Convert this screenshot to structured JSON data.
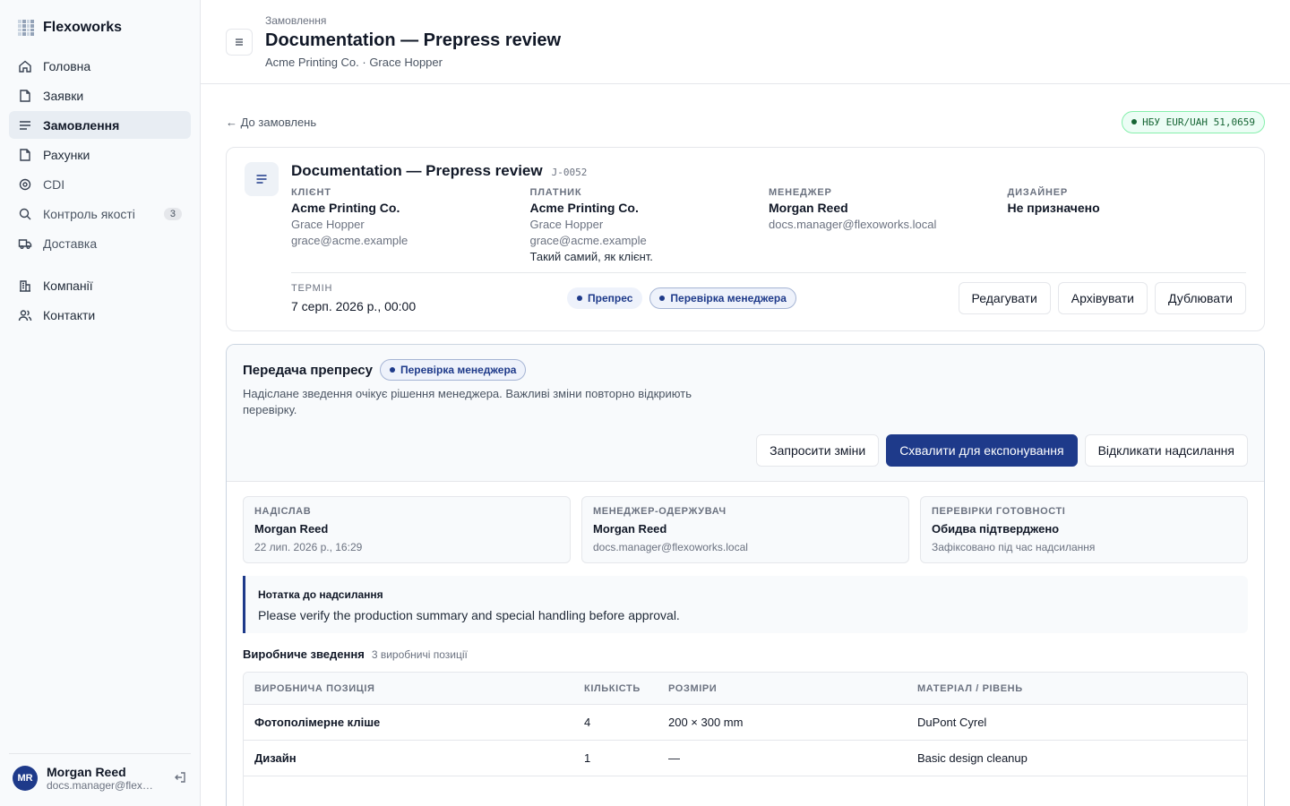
{
  "brand": {
    "name": "Flexoworks"
  },
  "sidebar": {
    "items": [
      {
        "label": "Головна",
        "icon": "home-icon"
      },
      {
        "label": "Заявки",
        "icon": "file-icon"
      },
      {
        "label": "Замовлення",
        "icon": "list-icon",
        "active": true
      },
      {
        "label": "Рахунки",
        "icon": "file-icon"
      },
      {
        "label": "CDI",
        "icon": "target-icon"
      },
      {
        "label": "Контроль якості",
        "icon": "search-icon",
        "count": "3"
      },
      {
        "label": "Доставка",
        "icon": "truck-icon"
      }
    ],
    "secondary": [
      {
        "label": "Компанії",
        "icon": "building-icon"
      },
      {
        "label": "Контакти",
        "icon": "users-icon"
      }
    ],
    "user": {
      "initials": "MR",
      "name": "Morgan Reed",
      "email": "docs.manager@flexoworks.local"
    }
  },
  "header": {
    "breadcrumb": "Замовлення",
    "title": "Documentation — Prepress review",
    "subtitle": "Acme Printing Co. · Grace Hopper"
  },
  "back_link": "← До замовлень",
  "rate": "НБУ EUR/UAH 51,0659",
  "order": {
    "title": "Documentation — Prepress review",
    "id": "J-0052",
    "client": {
      "label": "КЛІЄНТ",
      "name": "Acme Printing Co.",
      "contact": "Grace Hopper",
      "email": "grace@acme.example"
    },
    "payer": {
      "label": "ПЛАТНИК",
      "name": "Acme Printing Co.",
      "contact": "Grace Hopper",
      "email": "grace@acme.example",
      "note": "Такий самий, як клієнт."
    },
    "manager": {
      "label": "МЕНЕДЖЕР",
      "name": "Morgan Reed",
      "email": "docs.manager@flexoworks.local"
    },
    "designer": {
      "label": "ДИЗАЙНЕР",
      "name": "Не призначено"
    },
    "term": {
      "label": "ТЕРМІН",
      "value": "7 серп. 2026 р., 00:00"
    },
    "badges": [
      "Препрес",
      "Перевірка менеджера"
    ],
    "actions": {
      "edit": "Редагувати",
      "archive": "Архівувати",
      "duplicate": "Дублювати"
    }
  },
  "handoff": {
    "title": "Передача препресу",
    "badge": "Перевірка менеджера",
    "description": "Надіслане зведення очікує рішення менеджера. Важливі зміни повторно відкриють перевірку.",
    "actions": {
      "request": "Запросити зміни",
      "approve": "Схвалити для експонування",
      "recall": "Відкликати надсилання"
    },
    "sent_by": {
      "label": "НАДІСЛАВ",
      "value": "Morgan Reed",
      "sub": "22 лип. 2026 р., 16:29"
    },
    "recipient": {
      "label": "МЕНЕДЖЕР-ОДЕРЖУВАЧ",
      "value": "Morgan Reed",
      "sub": "docs.manager@flexoworks.local"
    },
    "readiness": {
      "label": "ПЕРЕВІРКИ ГОТОВНОСТІ",
      "value": "Обидва підтверджено",
      "sub": "Зафіксовано під час надсилання"
    },
    "note": {
      "title": "Нотатка до надсилання",
      "text": "Please verify the production summary and special handling before approval."
    },
    "summary": {
      "title": "Виробниче зведення",
      "count": "3 виробничі позиції",
      "headers": [
        "ВИРОБНИЧА ПОЗИЦІЯ",
        "КІЛЬКІСТЬ",
        "РОЗМІРИ",
        "МАТЕРІАЛ / РІВЕНЬ"
      ],
      "rows": [
        {
          "item": "Фотополімерне кліше",
          "qty": "4",
          "size": "200 × 300 mm",
          "material": "DuPont Cyrel"
        },
        {
          "item": "Дизайн",
          "qty": "1",
          "size": "—",
          "material": "Basic design cleanup"
        }
      ]
    }
  },
  "colors": {
    "accent": "#1e3a8a",
    "rate_bg": "#ecfdf5",
    "rate_text": "#166534"
  }
}
